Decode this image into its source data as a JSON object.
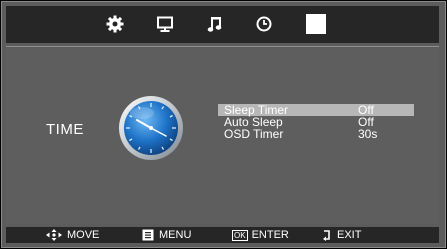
{
  "tabs": [
    {
      "name": "gear-icon"
    },
    {
      "name": "monitor-icon"
    },
    {
      "name": "music-note-icon"
    },
    {
      "name": "clock-icon"
    },
    {
      "name": "lock-block-icon"
    }
  ],
  "section": {
    "label": "TIME",
    "icon": "clock-icon"
  },
  "menu": {
    "items": [
      {
        "label": "Sleep Timer",
        "value": "Off",
        "selected": true
      },
      {
        "label": "Auto Sleep",
        "value": "Off",
        "selected": false
      },
      {
        "label": "OSD Timer",
        "value": "30s",
        "selected": false
      }
    ]
  },
  "hints": {
    "move": "MOVE",
    "menu": "MENU",
    "enter": "ENTER",
    "ok_key": "OK",
    "exit": "EXIT"
  },
  "colors": {
    "background": "#5c5c5c",
    "bar": "#262626",
    "selection": "#b7b7b7",
    "clock_blue": "#1f74c9"
  }
}
